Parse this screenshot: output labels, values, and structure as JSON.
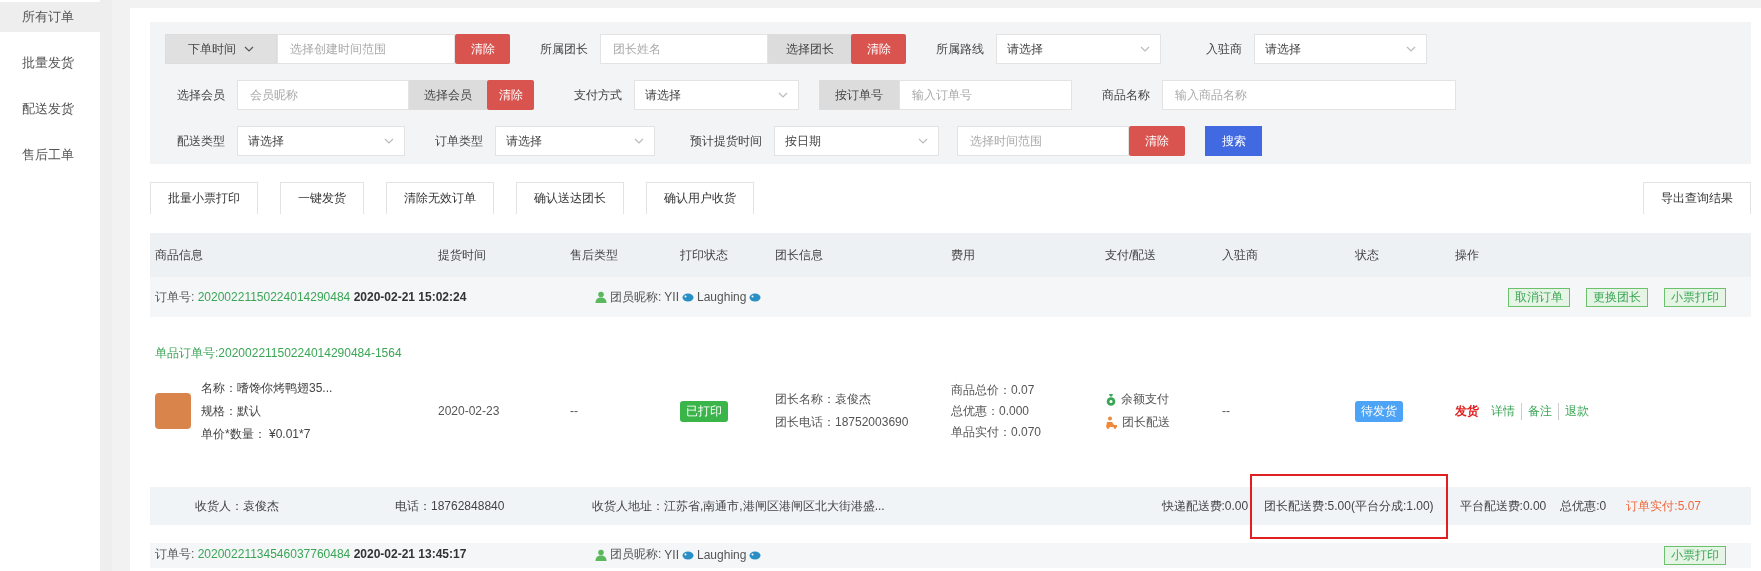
{
  "sidebar": {
    "items": [
      {
        "label": "所有订单",
        "selected": true
      },
      {
        "label": "批量发货",
        "selected": false
      },
      {
        "label": "配送发货",
        "selected": false
      },
      {
        "label": "售后工单",
        "selected": false
      }
    ]
  },
  "filters": {
    "rows": [
      {
        "items": [
          {
            "kind": "dropdown_button",
            "label": "下单时间"
          },
          {
            "kind": "input",
            "placeholder": "选择创建时间范围"
          },
          {
            "kind": "danger",
            "label": "清除"
          },
          {
            "kind": "label",
            "text": "所属团长"
          },
          {
            "kind": "input",
            "placeholder": "团长姓名"
          },
          {
            "kind": "addon",
            "label": "选择团长"
          },
          {
            "kind": "danger",
            "label": "清除"
          },
          {
            "kind": "label",
            "text": "所属路线"
          },
          {
            "kind": "select",
            "value": "请选择"
          },
          {
            "kind": "label",
            "text": "入驻商"
          },
          {
            "kind": "select",
            "value": "请选择"
          }
        ]
      },
      {
        "items": [
          {
            "kind": "label",
            "text": "选择会员"
          },
          {
            "kind": "input",
            "placeholder": "会员昵称"
          },
          {
            "kind": "addon",
            "label": "选择会员"
          },
          {
            "kind": "danger",
            "label": "清除"
          },
          {
            "kind": "label",
            "text": "支付方式"
          },
          {
            "kind": "select",
            "value": "请选择"
          },
          {
            "kind": "addon",
            "label": "按订单号"
          },
          {
            "kind": "input",
            "placeholder": "输入订单号"
          },
          {
            "kind": "label",
            "text": "商品名称"
          },
          {
            "kind": "input",
            "placeholder": "输入商品名称"
          }
        ]
      },
      {
        "items": [
          {
            "kind": "label",
            "text": "配送类型"
          },
          {
            "kind": "select",
            "value": "请选择"
          },
          {
            "kind": "label",
            "text": "订单类型"
          },
          {
            "kind": "select",
            "value": "请选择"
          },
          {
            "kind": "label",
            "text": "预计提货时间"
          },
          {
            "kind": "select",
            "value": "按日期"
          },
          {
            "kind": "input",
            "placeholder": "选择时间范围"
          },
          {
            "kind": "danger",
            "label": "清除"
          },
          {
            "kind": "primary",
            "label": "搜索"
          }
        ]
      }
    ]
  },
  "toolbar": {
    "buttons": [
      "批量小票打印",
      "一键发货",
      "清除无效订单",
      "确认送达团长",
      "确认用户收货"
    ],
    "export_button": "导出查询结果"
  },
  "table": {
    "columns": [
      "商品信息",
      "提货时间",
      "售后类型",
      "打印状态",
      "团长信息",
      "费用",
      "支付/配送",
      "入驻商",
      "状态",
      "操作"
    ],
    "orders": [
      {
        "order_no_label": "订单号:",
        "order_no": "20200221150224014290484",
        "created": "2020-02-21 15:02:24",
        "nickname_label": "团员昵称:",
        "nickname_parts": [
          "YII",
          "Laughing"
        ],
        "header_actions": [
          "取消订单",
          "更换团长",
          "小票打印"
        ],
        "items": [
          {
            "sub_order": "单品订单号:20200221150224014290484-1564",
            "name": "名称：嗜馋你烤鸭翅35...",
            "spec": "规格：默认",
            "price": "单价*数量：  ¥0.01*7",
            "pickup_date": "2020-02-23",
            "after_sale": "--",
            "print_status": {
              "label": "已打印",
              "printed": true
            },
            "leader_name": "团长名称：袁俊杰",
            "leader_phone": "团长电话：18752003690",
            "fees": [
              "商品总价：0.07",
              "总优惠：0.000",
              "单品实付：0.070"
            ],
            "payment": [
              {
                "kind": "balance",
                "label": "余额支付"
              },
              {
                "kind": "delivery",
                "label": "团长配送"
              }
            ],
            "merchant": "--",
            "status": {
              "label": "待发货",
              "kind": "pending"
            },
            "actions": [
              {
                "kind": "primary",
                "label": "发货"
              },
              {
                "kind": "link",
                "label": "详情"
              },
              {
                "kind": "link",
                "label": "备注"
              },
              {
                "kind": "link",
                "label": "退款"
              }
            ]
          }
        ],
        "footer": {
          "left": [
            "收货人：袁俊杰",
            "电话：18762848840",
            "收货人地址：江苏省,南通市,港闸区港闸区北大街港盛..."
          ],
          "right": [
            {
              "text": "快递配送费:0.00",
              "highlighted": false,
              "kind": "fee"
            },
            {
              "text": "团长配送费:5.00(平台分成:1.00)",
              "highlighted": true,
              "kind": "fee"
            },
            {
              "text": "平台配送费:0.00",
              "highlighted": false,
              "kind": "fee"
            },
            {
              "text": "总优惠:0",
              "highlighted": false,
              "kind": "fee"
            },
            {
              "text": "订单实付:5.07",
              "highlighted": false,
              "kind": "total"
            }
          ]
        }
      },
      {
        "order_no_label": "订单号:",
        "order_no": "20200221134546037760484",
        "created": "2020-02-21 13:45:17",
        "nickname_label": "团员昵称:",
        "nickname_parts": [
          "YII",
          "Laughing"
        ],
        "header_actions": [
          "小票打印"
        ]
      }
    ]
  }
}
